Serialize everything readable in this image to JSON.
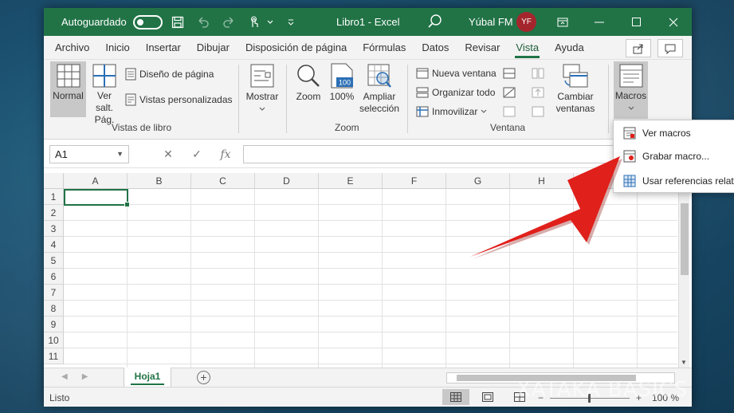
{
  "titlebar": {
    "autosave_label": "Autoguardado",
    "doc_title": "Libro1  -  Excel",
    "user_name": "Yúbal FM",
    "user_initials": "YF"
  },
  "tabs": [
    {
      "label": "Archivo"
    },
    {
      "label": "Inicio"
    },
    {
      "label": "Insertar"
    },
    {
      "label": "Dibujar"
    },
    {
      "label": "Disposición de página"
    },
    {
      "label": "Fórmulas"
    },
    {
      "label": "Datos"
    },
    {
      "label": "Revisar"
    },
    {
      "label": "Vista",
      "active": true
    },
    {
      "label": "Ayuda"
    }
  ],
  "ribbon": {
    "normal": "Normal",
    "ver_salt_1": "Ver salt.",
    "ver_salt_2": "Pág.",
    "diseno_pagina": "Diseño de página",
    "vistas_personalizadas": "Vistas personalizadas",
    "group_vistas": "Vistas de libro",
    "mostrar": "Mostrar",
    "zoom": "Zoom",
    "zoom_100": "100%",
    "ampliar_1": "Ampliar",
    "ampliar_2": "selección",
    "group_zoom": "Zoom",
    "nueva_ventana": "Nueva ventana",
    "organizar_todo": "Organizar todo",
    "inmovilizar": "Inmovilizar",
    "cambiar_1": "Cambiar",
    "cambiar_2": "ventanas",
    "group_ventana": "Ventana",
    "macros": "Macros",
    "icon_100_text": "100"
  },
  "formulabar": {
    "namebox": "A1",
    "fx": "fx"
  },
  "grid": {
    "columns": [
      "A",
      "B",
      "C",
      "D",
      "E",
      "F",
      "G",
      "H",
      "I"
    ],
    "rows": [
      "1",
      "2",
      "3",
      "4",
      "5",
      "6",
      "7",
      "8",
      "9",
      "10",
      "11"
    ]
  },
  "sheets": {
    "active": "Hoja1"
  },
  "status": {
    "text": "Listo",
    "zoom": "100 %"
  },
  "macros_menu": {
    "ver_macros": "Ver macros",
    "grabar_macro": "Grabar macro...",
    "usar_referencias": "Usar referencias relativas"
  },
  "watermark": "XATAKA BASICS",
  "colors": {
    "excel_green": "#217346",
    "arrow_red": "#e0201b"
  }
}
